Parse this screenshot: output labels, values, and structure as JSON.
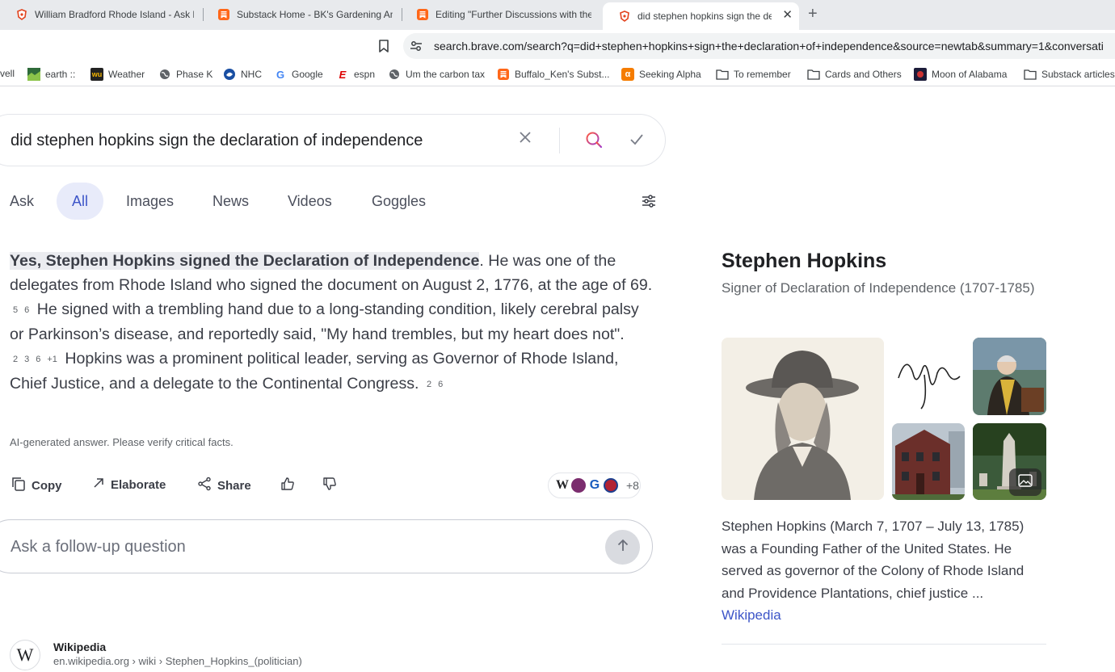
{
  "browser": {
    "tabs": [
      {
        "title": "William Bradford Rhode Island - Ask B",
        "icon": "brave-icon"
      },
      {
        "title": "Substack Home - BK's Gardening Am",
        "icon": "substack-icon"
      },
      {
        "title": "Editing \"Further Discussions with the",
        "icon": "substack-icon"
      },
      {
        "title": "did stephen hopkins sign the dec",
        "icon": "brave-icon",
        "active": true
      }
    ],
    "url": "search.brave.com/search?q=did+stephen+hopkins+sign+the+declaration+of+independence&source=newtab&summary=1&conversati",
    "bookmarks": [
      {
        "label": "vell",
        "icon": ""
      },
      {
        "label": "earth ::",
        "icon": "earth-icon"
      },
      {
        "label": "Weather",
        "icon": "weather-icon"
      },
      {
        "label": "Phase K",
        "icon": "globe-icon"
      },
      {
        "label": "NHC",
        "icon": "nhc-icon"
      },
      {
        "label": "Google",
        "icon": "google-icon"
      },
      {
        "label": "espn",
        "icon": "espn-icon"
      },
      {
        "label": "Um the carbon tax",
        "icon": "globe-icon"
      },
      {
        "label": "Buffalo_Ken's Subst...",
        "icon": "substack-icon"
      },
      {
        "label": "Seeking Alpha",
        "icon": "seeking-alpha-icon"
      },
      {
        "label": "To remember",
        "icon": "folder-icon"
      },
      {
        "label": "Cards and Others",
        "icon": "folder-icon"
      },
      {
        "label": "Moon of Alabama",
        "icon": "moon-icon"
      },
      {
        "label": "Substack articles",
        "icon": "folder-icon"
      }
    ]
  },
  "search": {
    "query": "did stephen hopkins sign the declaration of independence"
  },
  "nav_tabs": [
    "Ask",
    "All",
    "Images",
    "News",
    "Videos",
    "Goggles"
  ],
  "answer": {
    "highlight": "Yes, Stephen Hopkins signed the Declaration of Independence",
    "p1": ". He was one of the delegates from Rhode Island who signed the document on August 2, 1776, at the age of 69.",
    "c1a": "5",
    "c1b": "6",
    "p2": "He signed with a trembling hand due to a long-standing condition, likely cerebral palsy or Parkinson’s disease, and reportedly said, \"My hand trembles, but my heart does not\".",
    "c2a": "2",
    "c2b": "3",
    "c2c": "6",
    "c2d": "+1",
    "p3": "Hopkins was a prominent political leader, serving as Governor of Rhode Island, Chief Justice, and a delegate to the Continental Congress.",
    "c3a": "2",
    "c3b": "6",
    "disclaimer": "AI-generated answer. Please verify critical facts."
  },
  "actions": {
    "copy": "Copy",
    "elaborate": "Elaborate",
    "share": "Share",
    "sources_more": "+8"
  },
  "followup": {
    "placeholder": "Ask a follow-up question"
  },
  "result": {
    "site": "Wikipedia",
    "crumb": "en.wikipedia.org › wiki › Stephen_Hopkins_(politician)",
    "logo": "W"
  },
  "knowledge_panel": {
    "title": "Stephen Hopkins",
    "subtitle": "Signer of Declaration of Independence (1707-1785)",
    "description": "Stephen Hopkins (March 7, 1707 – July 13, 1785) was a Founding Father of the United States. He served as governor of the Colony of Rhode Island and Providence Plantations, chief justice",
    "ellipsis": "...",
    "link": "Wikipedia"
  },
  "colors": {
    "accent": "#3d55c8",
    "active_tab_bg": "#e8ebfa",
    "substack_orange": "#ff6719",
    "brave_orange": "#e2431e"
  }
}
